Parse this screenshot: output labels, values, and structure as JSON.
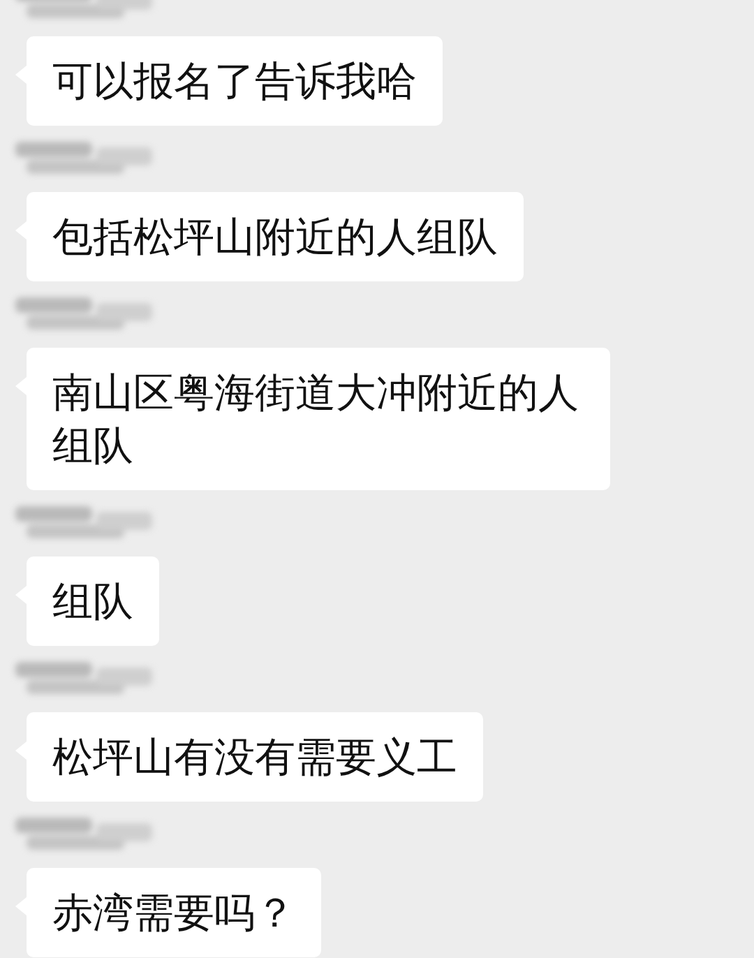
{
  "messages": [
    {
      "text": "可以报名了告诉我哈"
    },
    {
      "text": "包括松坪山附近的人组队"
    },
    {
      "text": "南山区粤海街道大冲附近的人组队"
    },
    {
      "text": "组队"
    },
    {
      "text": "松坪山有没有需要义工"
    },
    {
      "text": "赤湾需要吗？"
    }
  ]
}
